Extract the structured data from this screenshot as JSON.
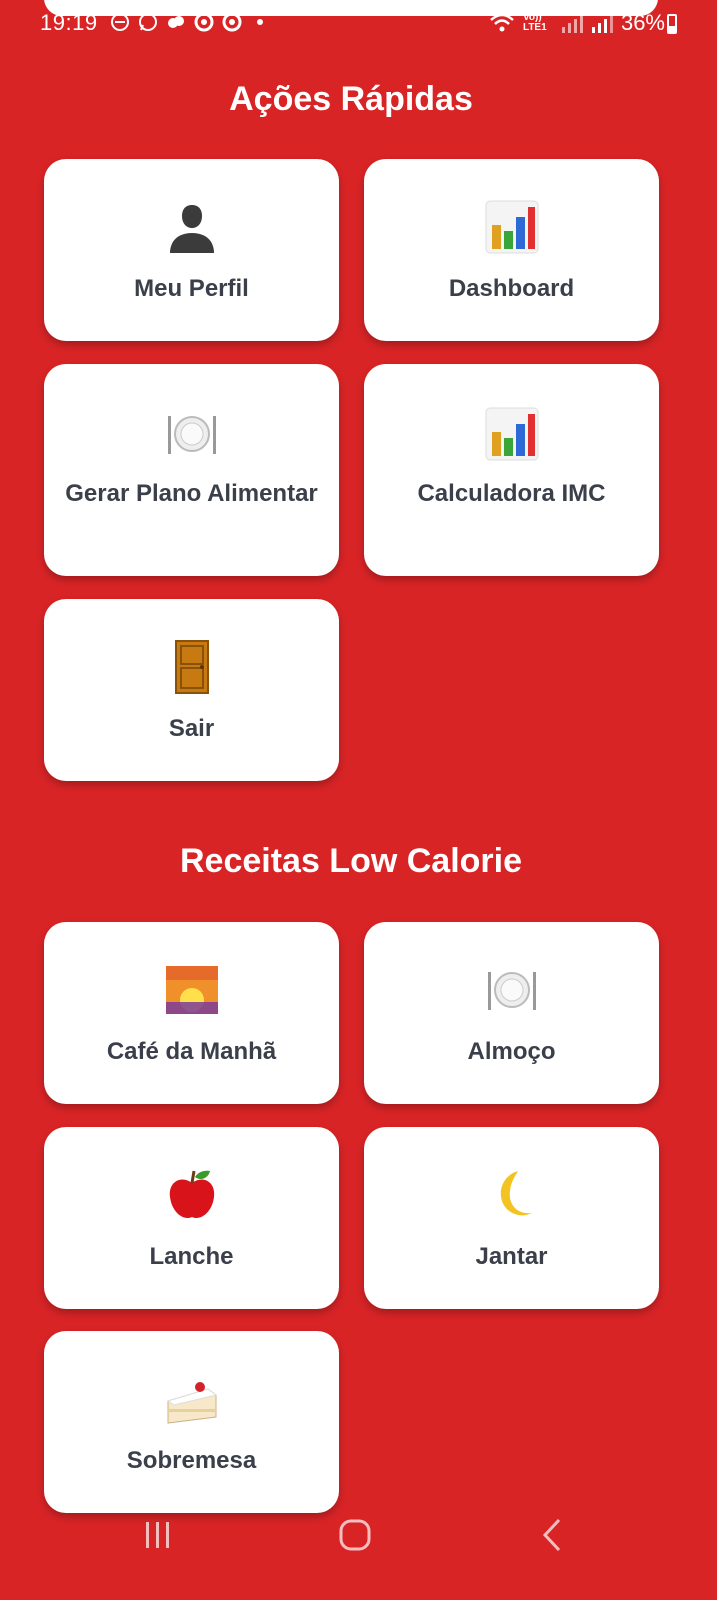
{
  "status_bar": {
    "time": "19:19",
    "signal_text": "Vo)) LTE1",
    "battery_percent": "36%"
  },
  "quick_actions": {
    "title": "Ações Rápidas",
    "items": [
      {
        "label": "Meu Perfil",
        "icon": "person-silhouette-icon"
      },
      {
        "label": "Dashboard",
        "icon": "bar-chart-icon"
      },
      {
        "label": "Gerar Plano Alimentar",
        "icon": "fork-knife-plate-icon"
      },
      {
        "label": "Calculadora IMC",
        "icon": "bar-chart-icon"
      },
      {
        "label": "Sair",
        "icon": "door-icon"
      }
    ]
  },
  "recipes": {
    "title": "Receitas Low Calorie",
    "items": [
      {
        "label": "Café da Manhã",
        "icon": "sunrise-icon"
      },
      {
        "label": "Almoço",
        "icon": "fork-knife-plate-icon"
      },
      {
        "label": "Lanche",
        "icon": "apple-icon"
      },
      {
        "label": "Jantar",
        "icon": "crescent-moon-icon"
      },
      {
        "label": "Sobremesa",
        "icon": "cake-slice-icon"
      }
    ]
  },
  "colors": {
    "background": "#d92426",
    "card": "#ffffff",
    "label": "#3a3f4a"
  }
}
